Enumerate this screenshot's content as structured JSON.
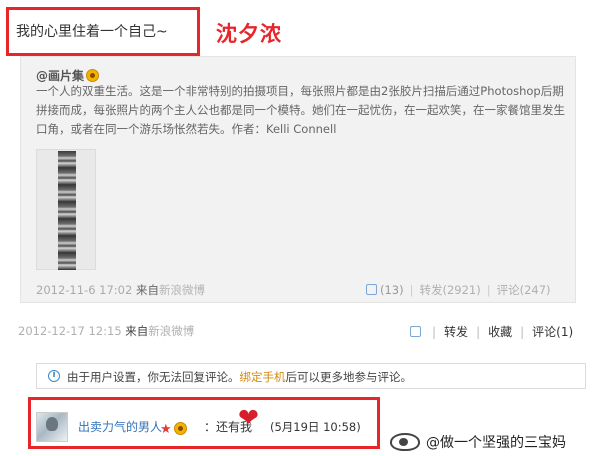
{
  "post": {
    "text": "我的心里住着一个自己~"
  },
  "author_tag": "沈夕浓",
  "repost": {
    "user": "@画片集",
    "body": "一个人的双重生活。这是一个非常特别的拍摄项目，每张照片都是由2张胶片扫描后通过Photoshop后期拼接而成，每张照片的两个主人公也都是同一个模特。她们在一起忧伤，在一起欢笑，在一家餐馆里发生口角，或者在同一个游乐场怅然若失。作者：Kelli Connell",
    "time": "2012-11-6 17:02",
    "source_label": "来自",
    "source": "新浪微博",
    "like_count": "(13)",
    "repost_label": "转发(2921)",
    "comment_label": "评论(247)"
  },
  "main": {
    "time": "2012-12-17 12:15",
    "source_label": "来自",
    "source": "新浪微博",
    "repost_label": "转发",
    "favorite_label": "收藏",
    "comment_label": "评论(1)"
  },
  "notice": {
    "prefix": "由于用户设置，你无法回复评论。",
    "link": "绑定手机",
    "suffix": "后可以更多地参与评论。"
  },
  "comment": {
    "user": "出卖力气的男人",
    "text": "：还有我",
    "time": "(5月19日 10:58)"
  },
  "watermark": "@做一个坚强的三宝妈",
  "colors": {
    "highlight_red": "#e8262a",
    "link_blue": "#3373b8",
    "heart": "#d71f2b"
  }
}
